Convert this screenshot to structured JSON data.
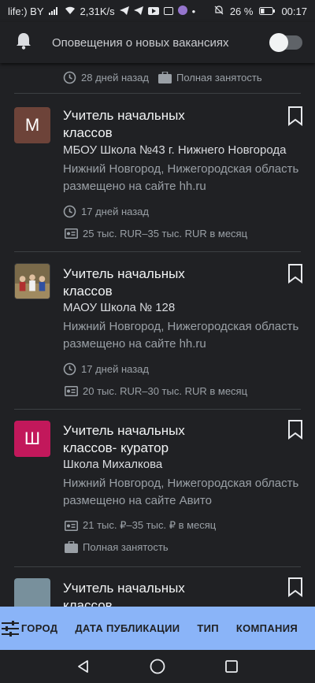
{
  "status": {
    "carrier": "life:) BY",
    "speed": "2,31K/s",
    "battery": "26 %",
    "time": "00:17"
  },
  "notification": {
    "label": "Оповещения о новых вакансиях",
    "toggle_on": false
  },
  "top_meta": {
    "posted": "28 дней назад",
    "employment": "Полная занятость"
  },
  "jobs": [
    {
      "logo_letter": "М",
      "logo_color": "#6d4339",
      "title_line1": "Учитель начальных",
      "title_line2": "классов",
      "company": "МБОУ Школа №43 г. Нижнего Новгорода",
      "location": "Нижний Новгород, Нижегородская область",
      "source": "размещено на сайте hh.ru",
      "posted": "17 дней назад",
      "salary": "25 тыс. RUR–35 тыс. RUR в месяц"
    },
    {
      "logo_letter": "",
      "logo_color": "#5a4a33",
      "title_line1": "Учитель начальных",
      "title_line2": "классов",
      "company": "МАОУ Школа № 128",
      "location": "Нижний Новгород, Нижегородская область",
      "source": "размещено на сайте hh.ru",
      "posted": "17 дней назад",
      "salary": "20 тыс. RUR–30 тыс. RUR в месяц"
    },
    {
      "logo_letter": "Ш",
      "logo_color": "#c2185b",
      "title_line1": "Учитель начальных",
      "title_line2": "классов- куратор",
      "company": "Школа Михалкова",
      "location": "Нижний Новгород, Нижегородская область",
      "source": "размещено на сайте Авито",
      "salary": "21 тыс. ₽–35 тыс. ₽ в месяц",
      "employment": "Полная занятость"
    },
    {
      "logo_letter": "",
      "logo_color": "#78909c",
      "title_line1": "Учитель начальных",
      "title_line2": "классов"
    }
  ],
  "filters": [
    "ГОРОД",
    "ДАТА ПУБЛИКАЦИИ",
    "ТИП",
    "КОМПАНИЯ"
  ]
}
